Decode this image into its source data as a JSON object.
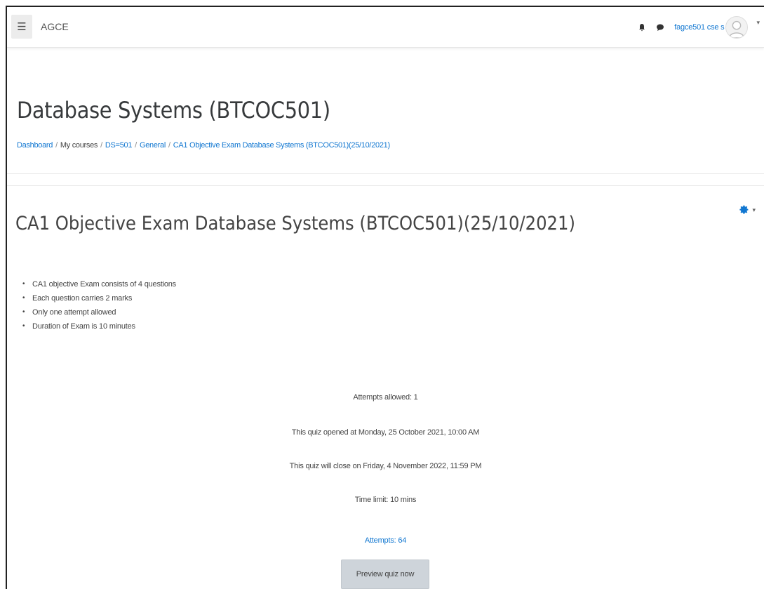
{
  "navbar": {
    "site_name": "AGCE",
    "username": "fagce501 cse s"
  },
  "header": {
    "course_title": "Database Systems (BTCOC501)",
    "breadcrumb": [
      "Dashboard",
      "My courses",
      "DS=501",
      "General",
      "CA1 Objective Exam Database Systems (BTCOC501)(25/10/2021)"
    ]
  },
  "main": {
    "quiz_title": "CA1 Objective Exam Database Systems (BTCOC501)(25/10/2021)",
    "rules": [
      "CA1 objective Exam consists of 4 questions",
      "Each question carries 2 marks",
      "Only one attempt allowed",
      "Duration of Exam is 10 minutes"
    ],
    "info": {
      "attempts_allowed": "Attempts allowed: 1",
      "opened": "This quiz opened at Monday, 25 October 2021, 10:00 AM",
      "closes": "This quiz will close on Friday, 4 November 2022, 11:59 PM",
      "time_limit": "Time limit: 10 mins"
    },
    "attempts_link": "Attempts: 64",
    "preview_button": "Preview quiz now"
  },
  "colors": {
    "link": "#1177d1",
    "button_bg": "#ced4da"
  }
}
